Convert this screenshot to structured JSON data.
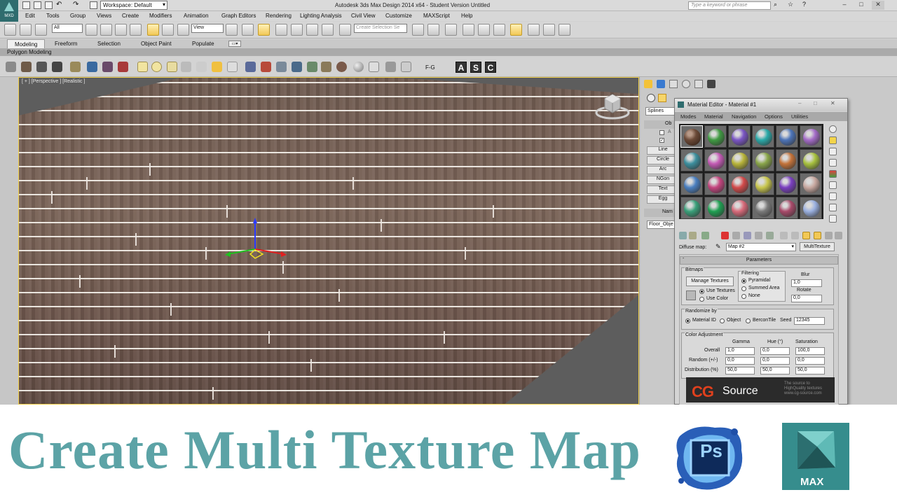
{
  "app": {
    "logo_label": "MXD",
    "workspace": "Workspace: Default",
    "title": "Autodesk 3ds Max Design 2014 x64 - Student Version  Untitled",
    "search_placeholder": "Type a keyword or phrase"
  },
  "menus": [
    "Edit",
    "Tools",
    "Group",
    "Views",
    "Create",
    "Modifiers",
    "Animation",
    "Graph Editors",
    "Rendering",
    "Lighting Analysis",
    "Civil View",
    "Customize",
    "MAXScript",
    "Help"
  ],
  "toolbar": {
    "filter": "All",
    "ref_coord": "View",
    "selection_set": "Create Selection Se"
  },
  "ribbon": {
    "tabs": [
      "Modeling",
      "Freeform",
      "Selection",
      "Object Paint",
      "Populate"
    ],
    "active_tab": "Modeling",
    "sub_label": "Polygon Modeling"
  },
  "toolbar2": {
    "fg_label": "F-G",
    "btn_a": "A",
    "btn_s": "S",
    "btn_c": "C"
  },
  "viewport": {
    "label": "[ + ] [Perspective ] [Realistic ]"
  },
  "command_panel": {
    "category": "Splines",
    "rollout_object": "Ob",
    "auto_grid": "A",
    "buttons": [
      "Line",
      "Circle",
      "Arc",
      "NGon",
      "Text",
      "Egg"
    ],
    "name_label": "Nam",
    "object_name": "Floor_Obje"
  },
  "material_editor": {
    "title": "Material Editor - Material #1",
    "menus": [
      "Modes",
      "Material",
      "Navigation",
      "Options",
      "Utilities"
    ],
    "swatch_colors": [
      "#6b4a38",
      "#3f9a42",
      "#7a55c4",
      "#2aa9a8",
      "#4d74b8",
      "#a46cc8",
      "#3c8f9e",
      "#c45ab5",
      "#b9b53a",
      "#8aa64a",
      "#c4733a",
      "#a8c23e",
      "#4a7fc0",
      "#c4447e",
      "#d24a4a",
      "#c8c64c",
      "#7a3fc0",
      "#c8a8a0",
      "#3aa07a",
      "#1ea052",
      "#d86a7a",
      "#7a7a7a",
      "#a84a6a",
      "#9ab0e0"
    ],
    "diffuse_label": "Diffuse map:",
    "map_name": "Map #2",
    "map_type": "MultiTexture",
    "params_title": "Parameters",
    "bitmaps": {
      "group": "Bitmaps",
      "manage": "Manage Textures",
      "use_textures": "Use Textures",
      "use_color": "Use Color"
    },
    "filtering": {
      "group": "Filtering",
      "pyramidal": "Pyramidal",
      "summed": "Summed Area",
      "none": "None"
    },
    "blur": {
      "label": "Blur",
      "value": "1,0"
    },
    "rotate": {
      "label": "Rotate",
      "value": "0,0"
    },
    "randomize": {
      "group": "Randomize by",
      "material_id": "Material ID",
      "object": "Object",
      "bercon": "BerconTile",
      "seed_label": "Seed",
      "seed": "12345"
    },
    "color_adj": {
      "group": "Color Adjustment",
      "col_gamma": "Gamma",
      "col_hue": "Hue (°)",
      "col_sat": "Saturation",
      "rows": [
        {
          "label": "Overall",
          "gamma": "1,0",
          "hue": "0,0",
          "sat": "100,0"
        },
        {
          "label": "Random (+/-)",
          "gamma": "0,0",
          "hue": "0,0",
          "sat": "0,0"
        },
        {
          "label": "Distribution (%)",
          "gamma": "50,0",
          "hue": "50,0",
          "sat": "50,0"
        }
      ]
    },
    "cg": {
      "cg": "CG",
      "source": "Source",
      "sub1": "The source to",
      "sub2": "HighQuality textures",
      "sub3": "www.cg-source.com"
    }
  },
  "banner": {
    "title": "Create Multi Texture Map",
    "ps_label": "Ps",
    "max_label": "MAX"
  }
}
